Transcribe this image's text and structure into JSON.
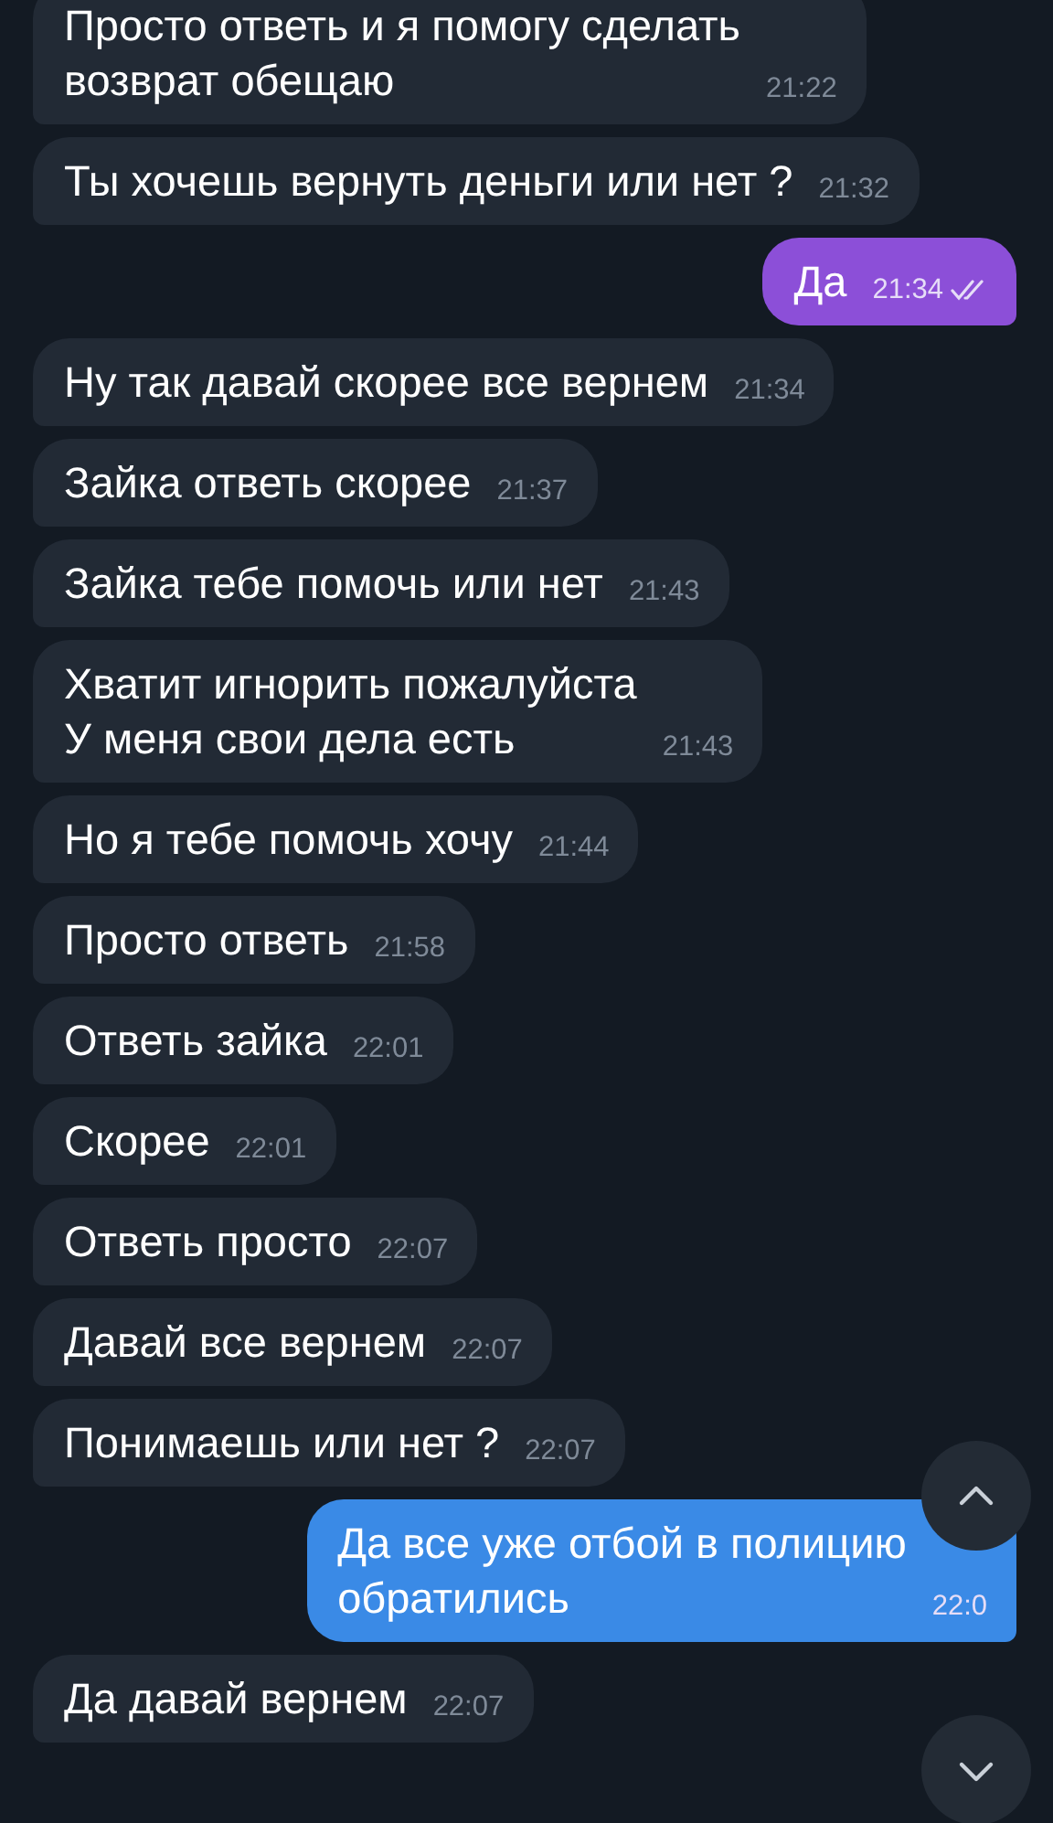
{
  "messages": [
    {
      "text": "Просто ответь и я помогу сделать\nвозврат обещаю",
      "time": "21:22",
      "outgoing": false
    },
    {
      "text": "Ты хочешь вернуть деньги или нет ?",
      "time": "21:32",
      "outgoing": false
    },
    {
      "text": "Да",
      "time": "21:34",
      "outgoing": true,
      "color": "#8c4fd8",
      "read": true
    },
    {
      "text": "Ну так давай скорее все вернем",
      "time": "21:34",
      "outgoing": false
    },
    {
      "text": "Зайка ответь скорее",
      "time": "21:37",
      "outgoing": false
    },
    {
      "text": "Зайка тебе помочь или нет",
      "time": "21:43",
      "outgoing": false
    },
    {
      "text": "Хватит игнорить пожалуйста\nУ меня свои дела есть",
      "time": "21:43",
      "outgoing": false
    },
    {
      "text": "Но я тебе помочь хочу",
      "time": "21:44",
      "outgoing": false
    },
    {
      "text": "Просто ответь",
      "time": "21:58",
      "outgoing": false
    },
    {
      "text": "Ответь зайка",
      "time": "22:01",
      "outgoing": false
    },
    {
      "text": "Скорее",
      "time": "22:01",
      "outgoing": false
    },
    {
      "text": "Ответь просто",
      "time": "22:07",
      "outgoing": false
    },
    {
      "text": "Давай все вернем",
      "time": "22:07",
      "outgoing": false
    },
    {
      "text": "Понимаешь или нет ?",
      "time": "22:07",
      "outgoing": false
    },
    {
      "text": "Да все уже отбой в полицию\nобратились",
      "time": "22:0",
      "outgoing": true,
      "color": "#3a8ae6"
    },
    {
      "text": "Да давай вернем",
      "time": "22:07",
      "outgoing": false
    }
  ],
  "scroll_buttons": [
    {
      "kind": "up"
    },
    {
      "kind": "down"
    }
  ]
}
